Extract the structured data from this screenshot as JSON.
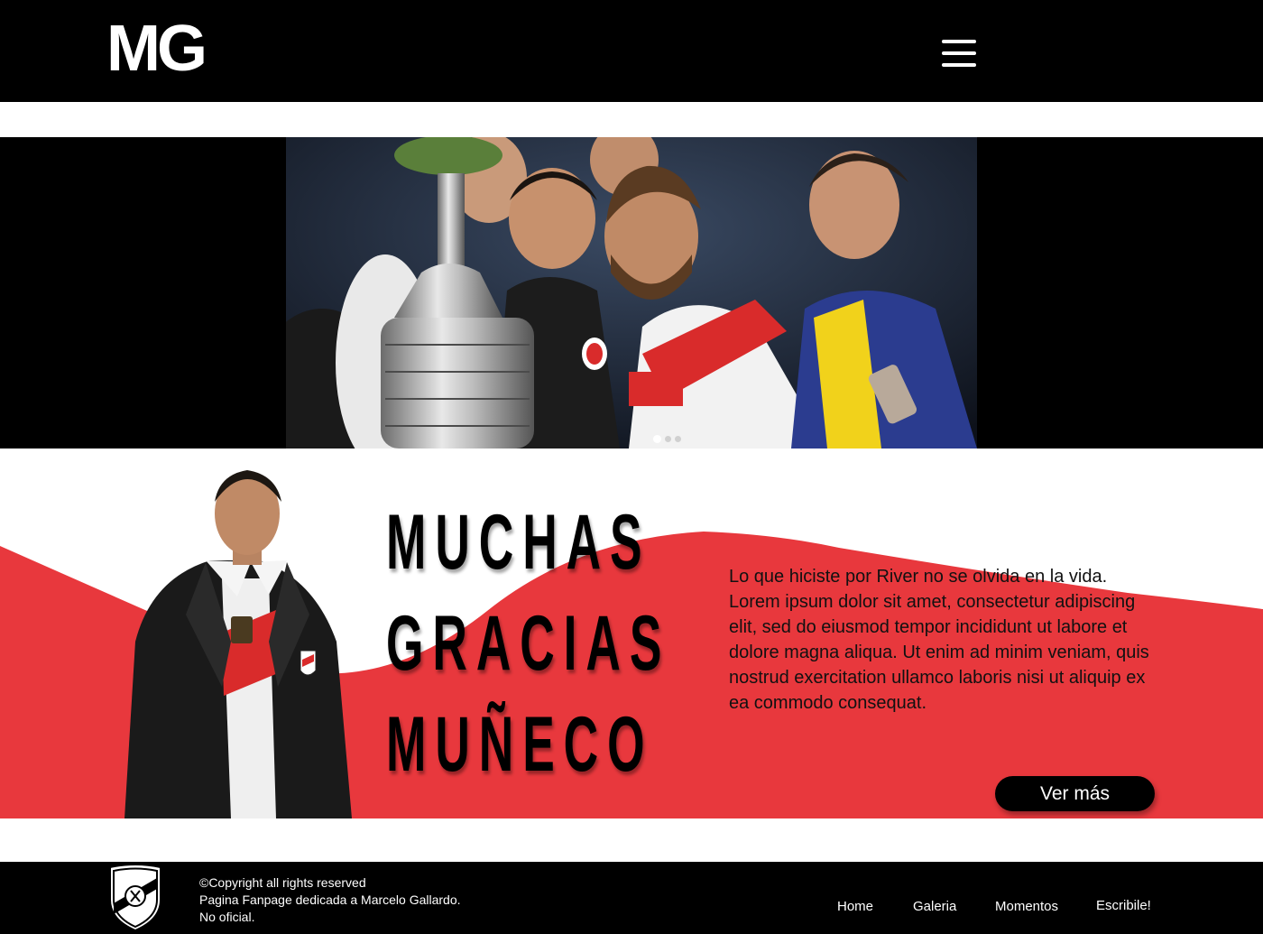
{
  "header": {
    "logo_text": "MG",
    "menu_icon": "hamburger-menu-icon"
  },
  "hero": {
    "slide_count": 3,
    "active_slide": 1
  },
  "tribute": {
    "headline_lines": [
      "MUCHAS",
      "GRACIAS",
      "MUÑECO"
    ],
    "body": "Lo que hiciste por River no se olvida en la vida. Lorem ipsum dolor sit amet, consectetur adipiscing elit, sed do eiusmod tempor incididunt ut labore et dolore magna aliqua. Ut enim ad minim veniam, quis nostrud exercitation ullamco laboris nisi ut aliquip ex ea commodo consequat.",
    "button_label": "Ver más"
  },
  "footer": {
    "copyright_lines": [
      "©Copyright all rights reserved",
      "Pagina Fanpage dedicada a Marcelo Gallardo.",
      "No oficial."
    ],
    "nav": [
      "Home",
      "Galeria",
      "Momentos",
      "Escribile!"
    ]
  },
  "colors": {
    "header_bg": "#000000",
    "accent_red": "#e8383d",
    "button_bg": "#000000",
    "footer_bg": "#000000"
  }
}
